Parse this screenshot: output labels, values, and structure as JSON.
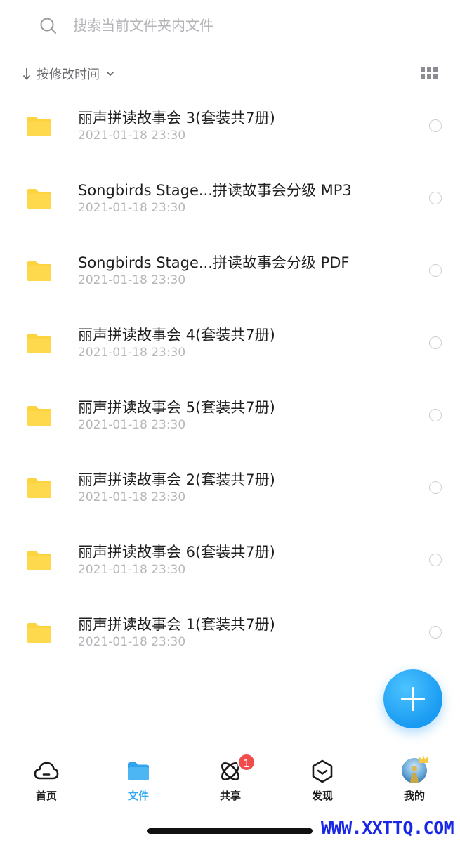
{
  "search": {
    "placeholder": "搜索当前文件夹内文件",
    "value": ""
  },
  "sort": {
    "label": "按修改时间"
  },
  "files": [
    {
      "name": "丽声拼读故事会 3(套装共7册)",
      "date": "2021-01-18 23:30"
    },
    {
      "name": "Songbirds Stage...拼读故事会分级 MP3",
      "date": "2021-01-18 23:30"
    },
    {
      "name": "Songbirds Stage...拼读故事会分级 PDF",
      "date": "2021-01-18 23:30"
    },
    {
      "name": "丽声拼读故事会 4(套装共7册)",
      "date": "2021-01-18 23:30"
    },
    {
      "name": "丽声拼读故事会 5(套装共7册)",
      "date": "2021-01-18 23:30"
    },
    {
      "name": "丽声拼读故事会 2(套装共7册)",
      "date": "2021-01-18 23:30"
    },
    {
      "name": "丽声拼读故事会 6(套装共7册)",
      "date": "2021-01-18 23:30"
    },
    {
      "name": "丽声拼读故事会 1(套装共7册)",
      "date": "2021-01-18 23:30"
    }
  ],
  "tabs": [
    {
      "label": "首页",
      "icon": "cloud-icon",
      "active": false
    },
    {
      "label": "文件",
      "icon": "folder-icon",
      "active": true
    },
    {
      "label": "共享",
      "icon": "atom-icon",
      "active": false,
      "badge": "1"
    },
    {
      "label": "发现",
      "icon": "discover-icon",
      "active": false
    },
    {
      "label": "我的",
      "icon": "avatar",
      "active": false
    }
  ],
  "watermark": "WWW.XXTTQ.COM",
  "colors": {
    "accent": "#33aaf2",
    "folder": "#fdd33f",
    "badge": "#f24d4d",
    "watermark": "#1a28e6"
  }
}
